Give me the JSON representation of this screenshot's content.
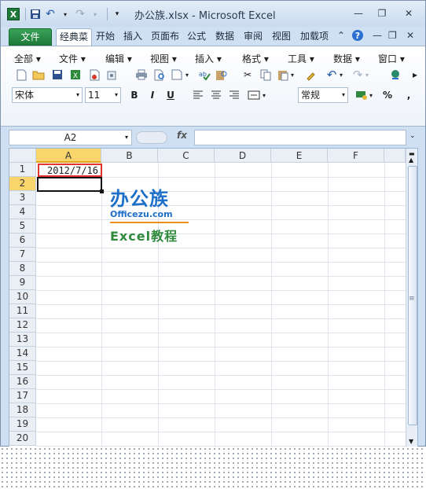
{
  "title": "办公族.xlsx - Microsoft Excel",
  "window_buttons": {
    "minimize": "—",
    "restore": "❐",
    "close": "✕"
  },
  "ribbon_tabs": [
    "文件",
    "经典菜单",
    "开始",
    "插入",
    "页面布局",
    "公式",
    "数据",
    "审阅",
    "视图",
    "加载项"
  ],
  "menu": [
    "全部 ▾",
    "文件 ▾",
    "编辑 ▾",
    "视图 ▾",
    "插入 ▾",
    "格式 ▾",
    "工具 ▾",
    "数据 ▾",
    "窗口 ▾"
  ],
  "font": {
    "name": "宋体",
    "size": "11"
  },
  "format_buttons": [
    "B",
    "I",
    "U"
  ],
  "number_format": "常规",
  "name_box": "A2",
  "fx_label": "fx",
  "columns": [
    "A",
    "B",
    "C",
    "D",
    "E",
    "F"
  ],
  "rows": [
    "1",
    "2",
    "3",
    "4",
    "5",
    "6",
    "7",
    "8",
    "9",
    "10",
    "11",
    "12",
    "13",
    "14",
    "15",
    "16",
    "17",
    "18",
    "19",
    "20"
  ],
  "cells": {
    "A1": "2012/7/16"
  },
  "selected_cell": "A2",
  "logo": {
    "cn": "办公族",
    "url": "Officezu.com",
    "excel": "Excel教程"
  }
}
